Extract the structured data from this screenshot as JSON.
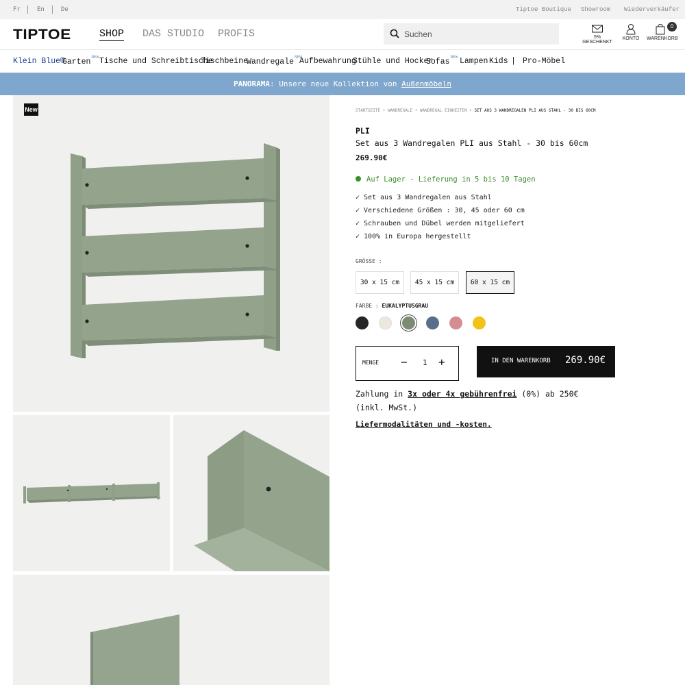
{
  "topbar": {
    "langs": [
      "Fr",
      "En",
      "De"
    ],
    "links": [
      "Tiptoe Boutique",
      "Showroom",
      "Wiederverkäufer"
    ]
  },
  "header": {
    "logo": "TIPTOE",
    "nav": [
      "SHOP",
      "DAS STUDIO",
      "PROFIS"
    ],
    "active_nav": "SHOP",
    "search_placeholder": "Suchen",
    "gift_label": "5% GESCHENKT",
    "account_label": "KONTO",
    "cart_label": "WARENKORB",
    "cart_count": "0"
  },
  "categories": [
    {
      "label": "Klein Blue®",
      "new": false,
      "blue": true
    },
    {
      "label": "Garten",
      "new": true
    },
    {
      "label": "Tische und Schreibtische",
      "new": false
    },
    {
      "label": "Tischbeine",
      "new": false
    },
    {
      "label": "Wandregale",
      "new": true
    },
    {
      "label": "Aufbewahrung",
      "new": false
    },
    {
      "label": "Stühle und Hocker",
      "new": false
    },
    {
      "label": "Sofas",
      "new": true
    },
    {
      "label": "Lampen",
      "new": false
    },
    {
      "label": "Kids",
      "new": false
    },
    {
      "label": "|",
      "new": false
    },
    {
      "label": "Pro-Möbel",
      "new": false
    }
  ],
  "new_sup": "NEW",
  "banner": {
    "bold": "PANORAMA",
    "text": ": Unsere neue Kollektion von ",
    "link": "Außenmöbeln"
  },
  "gallery": {
    "badge": "New"
  },
  "breadcrumb": [
    "STARTSEITE",
    "WANDREGALE",
    "WANDREGAL EINHEITEN",
    "SET AUS 3 WANDREGALEN PLI AUS STAHL - 30 BIS 60CM"
  ],
  "breadcrumb_sep": "•",
  "product": {
    "name": "PLI",
    "subtitle": "Set aus 3 Wandregalen PLI aus Stahl - 30 bis 60cm",
    "price": "269.90€",
    "stock": "Auf Lager - Lieferung in 5 bis 10 Tagen",
    "features": [
      "Set aus 3 Wandregalen aus Stahl",
      "Verschiedene Größen : 30, 45 oder 60 cm",
      "Schrauben und Dübel werden mitgeliefert",
      "100% in Europa hergestellt"
    ],
    "size_label": "GRÖSSE :",
    "sizes": [
      "30 x 15 cm",
      "45 x 15 cm",
      "60 x 15 cm"
    ],
    "selected_size": "60 x 15 cm",
    "color_label": "FARBE :",
    "color_value": "EUKALYPTUSGRAU",
    "colors": [
      "#262626",
      "#ece8dc",
      "#7c8b74",
      "#5a6e8c",
      "#d48d93",
      "#f2c218"
    ],
    "selected_color_index": 2,
    "qty_label": "MENGE",
    "qty_minus": "−",
    "qty_value": "1",
    "qty_plus": "+",
    "cart_button": "IN DEN WARENKORB",
    "cart_price": "269.90€",
    "payment_pre": "Zahlung in ",
    "payment_link": "3x oder 4x gebührenfrei",
    "payment_post": " (0%) ab 250€ (inkl. MwSt.)",
    "delivery_link": "Liefermodalitäten und -kosten."
  }
}
